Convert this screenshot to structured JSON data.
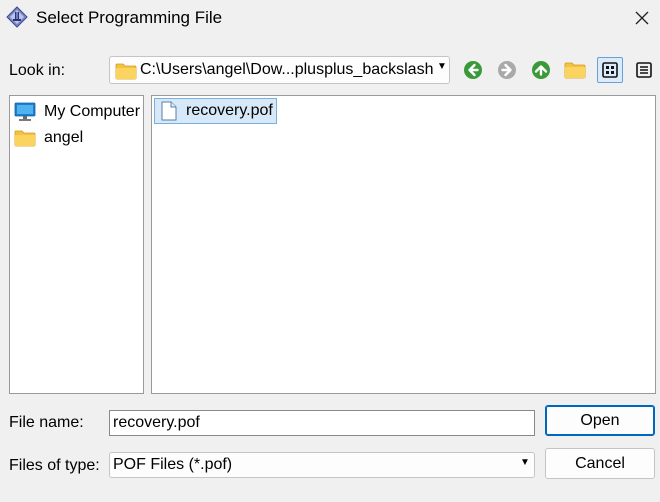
{
  "window": {
    "title": "Select Programming File",
    "app_icon": "programmer-app-icon",
    "close_icon": "close-icon"
  },
  "toolbar": {
    "look_in_label": "Look in:",
    "look_in_path": "C:\\Users\\angel\\Dow...plusplus_backslash",
    "buttons": [
      "back-icon",
      "forward-icon",
      "up-folder-icon",
      "new-folder-icon",
      "list-view-icon",
      "detail-view-icon"
    ]
  },
  "sidebar": {
    "items": [
      {
        "label": "My Computer",
        "icon": "computer-icon"
      },
      {
        "label": "angel",
        "icon": "folder-icon"
      }
    ]
  },
  "files": [
    {
      "name": "recovery.pof",
      "icon": "file-icon",
      "selected": true
    }
  ],
  "form": {
    "file_name_label": "File name:",
    "file_name_value": "recovery.pof",
    "files_of_type_label": "Files of type:",
    "files_of_type_value": "POF Files (*.pof)"
  },
  "buttons": {
    "open": "Open",
    "cancel": "Cancel"
  },
  "colors": {
    "selection": "#d7e8f8",
    "nav_green": "#3a9a3a",
    "accent": "#0067c0"
  }
}
